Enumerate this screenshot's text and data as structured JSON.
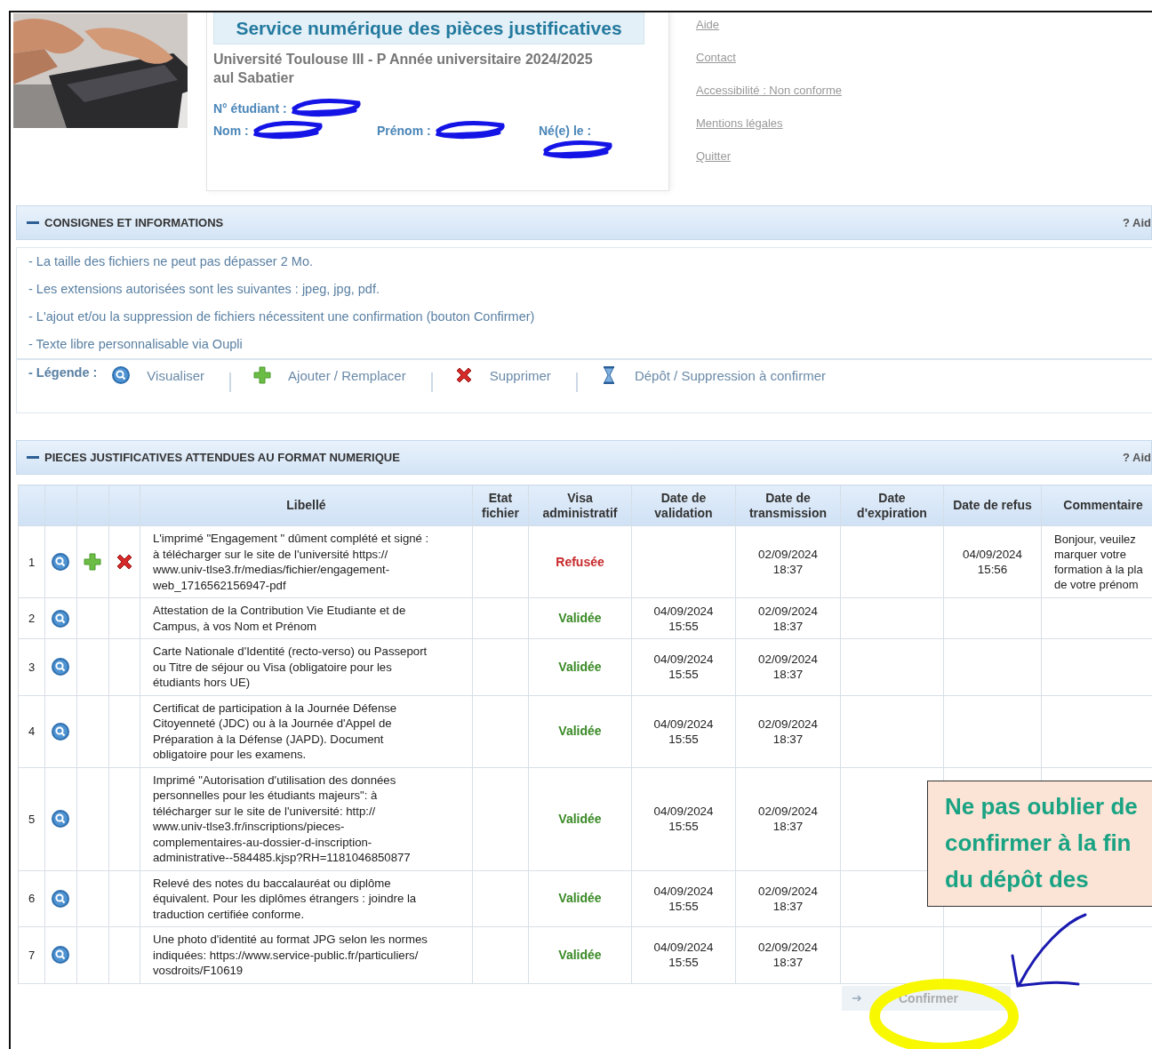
{
  "header": {
    "title": "Service numérique des pièces justificatives",
    "university_lines": [
      "Université Toulouse III - P Année universitaire 2024/2025",
      "aul Sabatier"
    ],
    "student_fields": [
      {
        "label": "N° étudiant :",
        "redacted": true
      },
      {
        "label": "Nom :",
        "redacted": true
      },
      {
        "label": "Prénom :",
        "redacted": true
      },
      {
        "label": "Né(e) le :",
        "redacted": true
      }
    ],
    "links": [
      "Aide",
      "Contact",
      "Accessibilité : Non conforme",
      "Mentions légales",
      "Quitter"
    ]
  },
  "instructions_section": {
    "title": "CONSIGNES ET INFORMATIONS",
    "help": "? Aid",
    "lines": [
      "- La taille des fichiers ne peut pas dépasser 2 Mo.",
      "- Les extensions autorisées sont les suivantes : jpeg, jpg, pdf.",
      "- L'ajout et/ou la suppression de fichiers nécessitent une confirmation (bouton Confirmer)",
      "- Texte libre personnalisable via Oupli"
    ],
    "legend": {
      "label": "- Légende :",
      "items": [
        {
          "kind": "view",
          "label": "Visualiser"
        },
        {
          "kind": "add",
          "label": "Ajouter / Remplacer"
        },
        {
          "kind": "delete",
          "label": "Supprimer"
        },
        {
          "kind": "pending",
          "label": "Dépôt / Suppression à confirmer"
        }
      ]
    }
  },
  "documents_section": {
    "title": "PIECES JUSTIFICATIVES ATTENDUES AU FORMAT NUMERIQUE",
    "help": "? Aid",
    "columns": [
      "Libellé",
      "Etat fichier",
      "Visa administratif",
      "Date de validation",
      "Date de transmission",
      "Date d'expiration",
      "Date de refus",
      "Commentaire"
    ],
    "rows": [
      {
        "number": "1",
        "actions": {
          "view": true,
          "add": true,
          "delete": true
        },
        "label_lines": [
          "L'imprimé \"Engagement \" dûment complété et signé :",
          "à télécharger sur le site de l'université https://",
          "www.univ-tlse3.fr/medias/fichier/engagement-",
          "web_1716562156947-pdf"
        ],
        "visa": "Refusée",
        "kind": "refused",
        "date_validation": "",
        "date_transmission": "02/09/2024 18:37",
        "date_refus": "04/09/2024 15:56",
        "comment_lines": [
          "Bonjour, veuilez",
          "marquer votre",
          "formation à la pla",
          "de votre prénom"
        ]
      },
      {
        "number": "2",
        "actions": {
          "view": true,
          "add": false,
          "delete": false
        },
        "label_lines": [
          "Attestation de la Contribution Vie Etudiante et de",
          "Campus, à vos Nom et Prénom"
        ],
        "visa": "Validée",
        "kind": "validated",
        "date_validation": "04/09/2024 15:55",
        "date_transmission": "02/09/2024 18:37",
        "date_refus": "",
        "comment_lines": []
      },
      {
        "number": "3",
        "actions": {
          "view": true,
          "add": false,
          "delete": false
        },
        "label_lines": [
          "Carte Nationale d'Identité (recto-verso) ou Passeport",
          "ou Titre de séjour ou Visa (obligatoire pour les",
          "étudiants hors UE)"
        ],
        "visa": "Validée",
        "kind": "validated",
        "date_validation": "04/09/2024 15:55",
        "date_transmission": "02/09/2024 18:37",
        "date_refus": "",
        "comment_lines": []
      },
      {
        "number": "4",
        "actions": {
          "view": true,
          "add": false,
          "delete": false
        },
        "label_lines": [
          "Certificat de participation à la Journée Défense",
          "Citoyenneté (JDC) ou à la Journée d'Appel de",
          "Préparation à la Défense (JAPD). Document",
          "obligatoire pour les examens."
        ],
        "visa": "Validée",
        "kind": "validated",
        "date_validation": "04/09/2024 15:55",
        "date_transmission": "02/09/2024 18:37",
        "date_refus": "",
        "comment_lines": []
      },
      {
        "number": "5",
        "actions": {
          "view": true,
          "add": false,
          "delete": false
        },
        "label_lines": [
          "Imprimé \"Autorisation d'utilisation des données",
          "personnelles pour les étudiants majeurs\": à",
          "télécharger sur le site de l'université: http://",
          "www.univ-tlse3.fr/inscriptions/pieces-",
          "complementaires-au-dossier-d-inscription-",
          "administrative--584485.kjsp?RH=1181046850877"
        ],
        "visa": "Validée",
        "kind": "validated",
        "date_validation": "04/09/2024 15:55",
        "date_transmission": "02/09/2024 18:37",
        "date_refus": "",
        "comment_lines": []
      },
      {
        "number": "6",
        "actions": {
          "view": true,
          "add": false,
          "delete": false
        },
        "label_lines": [
          "Relevé des notes du baccalauréat ou diplôme",
          "équivalent. Pour les diplômes étrangers : joindre la",
          "traduction certifiée conforme."
        ],
        "visa": "Validée",
        "kind": "validated",
        "date_validation": "04/09/2024 15:55",
        "date_transmission": "02/09/2024 18:37",
        "date_refus": "",
        "comment_lines": []
      },
      {
        "number": "7",
        "actions": {
          "view": true,
          "add": false,
          "delete": false
        },
        "label_lines": [
          "Une photo d'identité au format JPG selon les normes",
          "indiquées: https://www.service-public.fr/particuliers/",
          "vosdroits/F10619"
        ],
        "visa": "Validée",
        "kind": "validated",
        "date_validation": "04/09/2024 15:55",
        "date_transmission": "02/09/2024 18:37",
        "date_refus": "",
        "comment_lines": []
      }
    ],
    "confirm_button": {
      "label": "Confirmer",
      "disabled": true
    }
  },
  "callout": {
    "lines": [
      "Ne pas oublier de",
      "confirmer à la fin",
      "du dépôt des"
    ]
  }
}
